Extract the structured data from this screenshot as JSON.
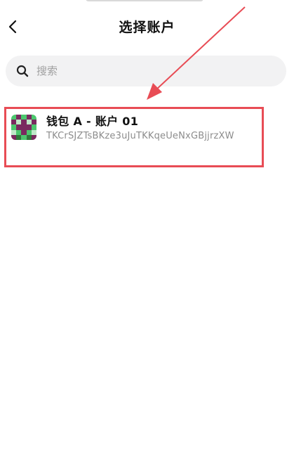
{
  "header": {
    "title": "选择账户"
  },
  "search": {
    "placeholder": "搜索",
    "value": ""
  },
  "accounts": [
    {
      "name": "钱包 A - 账户 01",
      "address": "TKCrSJZTsBKze3uJuTKKqeUeNxGBjjrzXW",
      "selected": true
    }
  ],
  "colors": {
    "highlight": "#e84c55",
    "avatar_purple": "#7a2a5f",
    "avatar_green": "#4cc76e",
    "avatar_dark": "#2f7a3a",
    "avatar_light": "#bfe8c8"
  },
  "icons": {
    "back": "chevron-left-icon",
    "search": "search-icon"
  }
}
